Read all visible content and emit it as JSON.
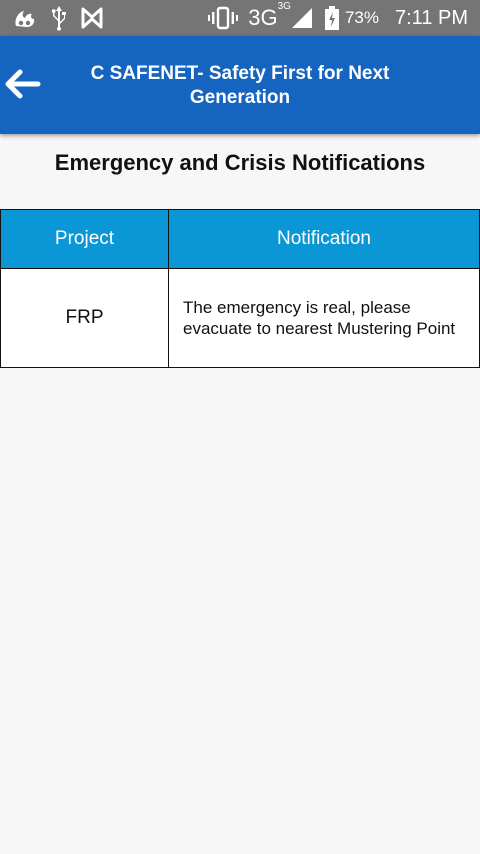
{
  "status_bar": {
    "network": "3G",
    "network_sup": "3G",
    "battery_percent": "73%",
    "time": "7:11 PM",
    "icons": [
      "uc-browser-icon",
      "usb-icon",
      "n-icon",
      "vibrate-icon",
      "signal-icon",
      "battery-charging-icon"
    ]
  },
  "app_bar": {
    "back_icon": "arrow-left-icon",
    "title": "C SAFENET- Safety First for Next Generation",
    "color": "#1565c0"
  },
  "page": {
    "heading": "Emergency and Crisis Notifications"
  },
  "table": {
    "header_color": "#0b97d5",
    "columns": [
      "Project",
      "Notification"
    ],
    "rows": [
      {
        "project": "FRP",
        "notification": "The emergency is real, please evacuate to nearest Mustering Point"
      }
    ]
  }
}
